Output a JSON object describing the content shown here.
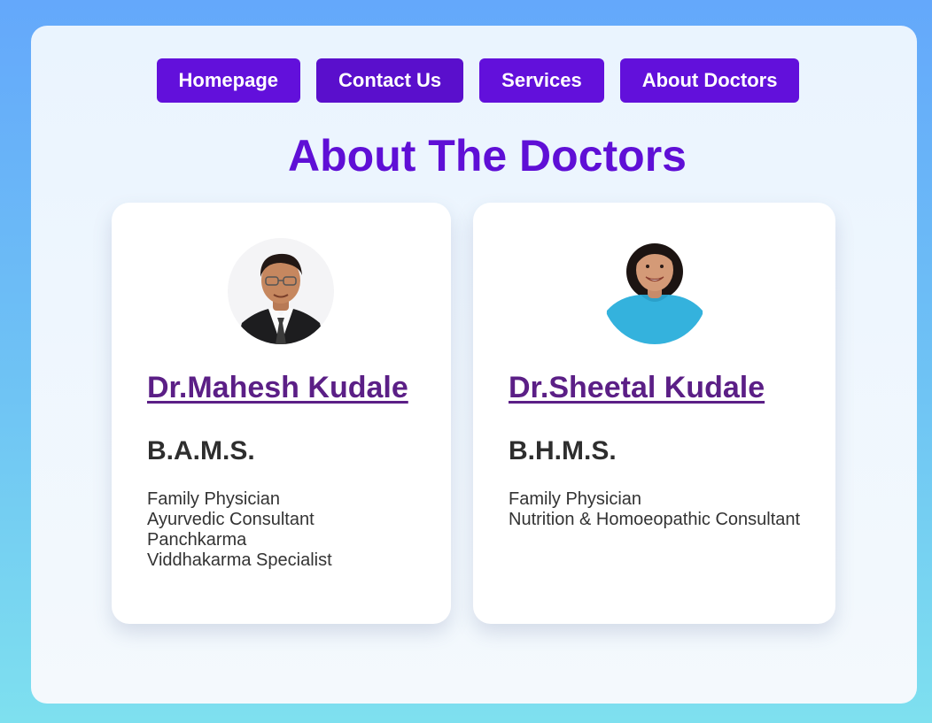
{
  "nav": {
    "items": [
      {
        "label": "Homepage"
      },
      {
        "label": "Contact Us"
      },
      {
        "label": "Services"
      },
      {
        "label": "About Doctors"
      }
    ]
  },
  "page": {
    "title": "About The Doctors"
  },
  "doctors": [
    {
      "name": "Dr.Mahesh Kudale",
      "degree": "B.A.M.S.",
      "roles": [
        "Family Physician",
        "Ayurvedic Consultant",
        "Panchkarma",
        "Viddhakarma Specialist"
      ]
    },
    {
      "name": "Dr.Sheetal Kudale",
      "degree": "B.H.M.S.",
      "roles": [
        "Family Physician",
        "Nutrition & Homoeopathic Consultant"
      ]
    }
  ],
  "colors": {
    "accent": "#6210db",
    "title": "#5f0fd6",
    "link": "#5b1f86"
  }
}
